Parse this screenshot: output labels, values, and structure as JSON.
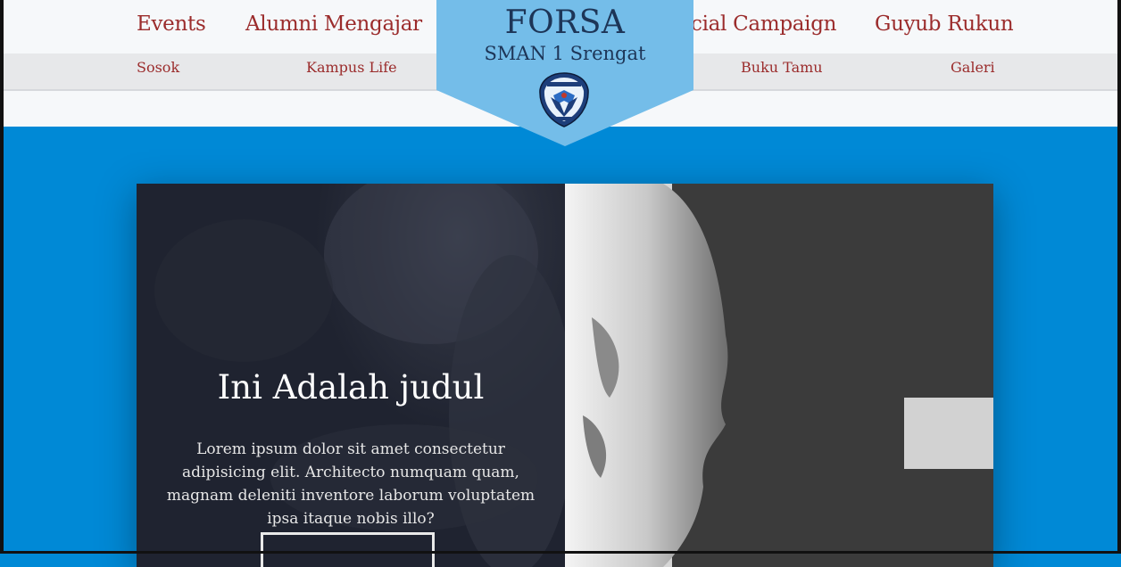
{
  "nav": {
    "main": [
      {
        "label": "Events",
        "name": "nav-events"
      },
      {
        "label": "Alumni Mengajar",
        "name": "nav-alumni-mengajar"
      },
      {
        "label": "Social Campaign",
        "name": "nav-social-campaign"
      },
      {
        "label": "Guyub Rukun",
        "name": "nav-guyub-rukun"
      }
    ],
    "sub": [
      {
        "label": "Sosok",
        "name": "nav-sosok"
      },
      {
        "label": "Kampus Life",
        "name": "nav-kampus-life"
      },
      {
        "label": "Buku Tamu",
        "name": "nav-buku-tamu"
      },
      {
        "label": "Galeri",
        "name": "nav-galeri"
      }
    ]
  },
  "brand": {
    "title": "FORSA",
    "subtitle": "SMAN 1 Srengat",
    "logo_icon": "school-crest-icon",
    "banner_color": "#74bde9"
  },
  "hero": {
    "title": "Ini Adalah judul",
    "text": "Lorem ipsum dolor sit amet consectetur adipisicing elit. Architecto numquam quam, magnam deleniti inventore laborum voluptatem ipsa itaque nobis illo?",
    "button_label": "",
    "image_icon": "statue-photo"
  },
  "colors": {
    "page_background": "#0089d6",
    "nav_link": "#9b2c2c",
    "brand_text": "#1d3557"
  }
}
